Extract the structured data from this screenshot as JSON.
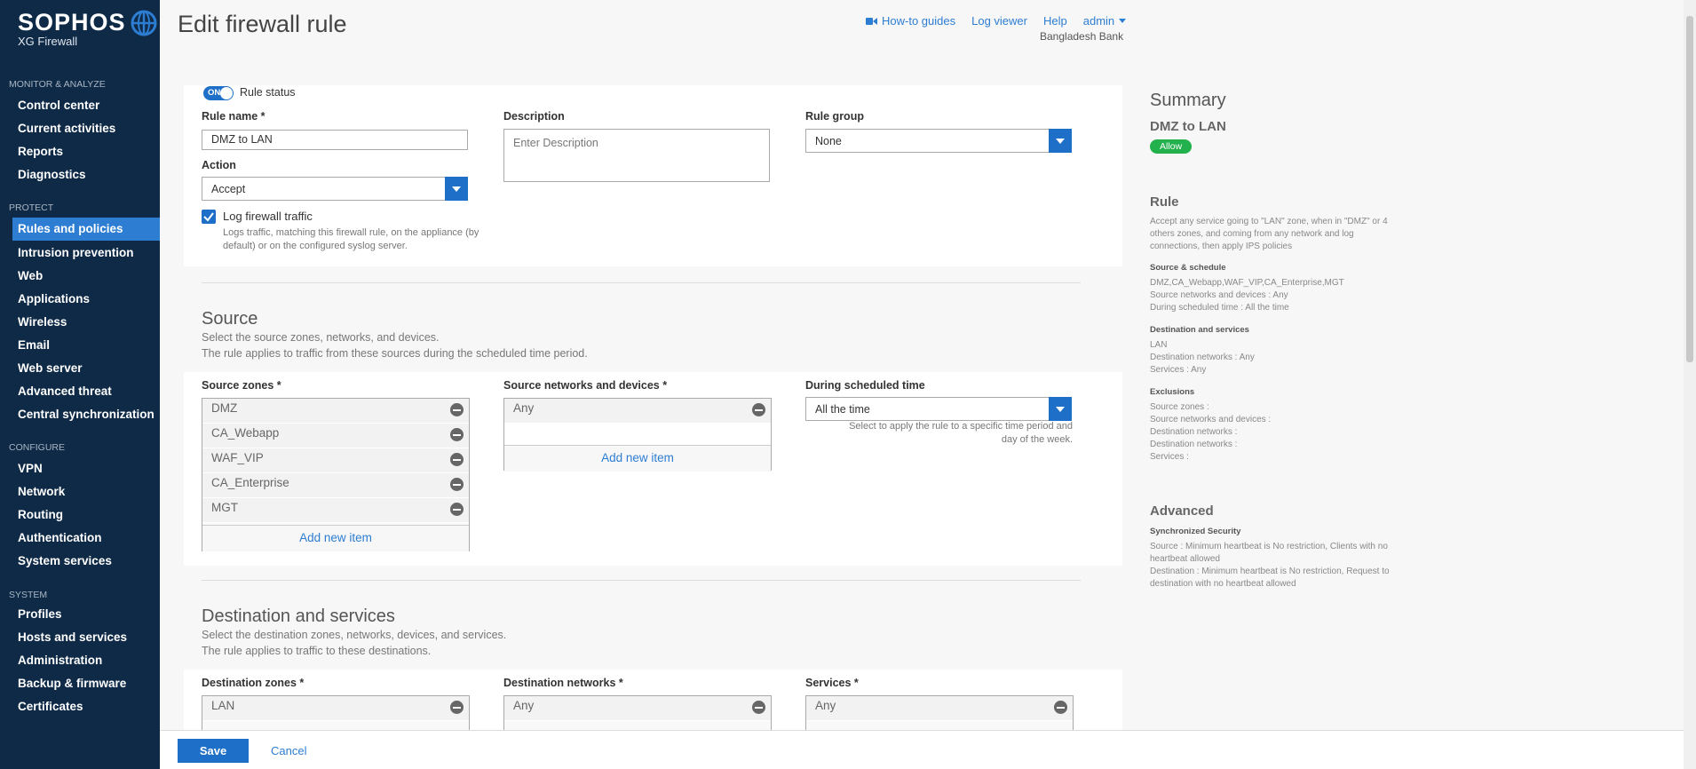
{
  "brand": {
    "name": "SOPHOS",
    "product": "XG Firewall"
  },
  "nav": {
    "sections": [
      {
        "label": "MONITOR & ANALYZE",
        "items": [
          "Control center",
          "Current activities",
          "Reports",
          "Diagnostics"
        ]
      },
      {
        "label": "PROTECT",
        "items": [
          "Rules and policies",
          "Intrusion prevention",
          "Web",
          "Applications",
          "Wireless",
          "Email",
          "Web server",
          "Advanced threat",
          "Central synchronization"
        ]
      },
      {
        "label": "CONFIGURE",
        "items": [
          "VPN",
          "Network",
          "Routing",
          "Authentication",
          "System services"
        ]
      },
      {
        "label": "SYSTEM",
        "items": [
          "Profiles",
          "Hosts and services",
          "Administration",
          "Backup & firmware",
          "Certificates"
        ]
      }
    ],
    "active": "Rules and policies"
  },
  "header": {
    "title": "Edit firewall rule",
    "links": {
      "howto": "How-to guides",
      "log": "Log viewer",
      "help": "Help",
      "admin": "admin"
    },
    "org": "Bangladesh Bank"
  },
  "rule": {
    "toggle_label": "ON",
    "status_label": "Rule status",
    "name_label": "Rule name *",
    "name_value": "DMZ to LAN",
    "desc_label": "Description",
    "desc_placeholder": "Enter Description",
    "group_label": "Rule group",
    "group_value": "None",
    "action_label": "Action",
    "action_value": "Accept",
    "log_label": "Log firewall traffic",
    "log_help": "Logs traffic, matching this firewall rule, on the appliance (by default) or on the configured syslog server."
  },
  "source": {
    "title": "Source",
    "desc1": "Select the source zones, networks, and devices.",
    "desc2": "The rule applies to traffic from these sources during the scheduled time period.",
    "zones_label": "Source zones *",
    "zones": [
      "DMZ",
      "CA_Webapp",
      "WAF_VIP",
      "CA_Enterprise",
      "MGT"
    ],
    "networks_label": "Source networks and devices *",
    "networks": [
      "Any"
    ],
    "schedule_label": "During scheduled time",
    "schedule_value": "All the time",
    "schedule_help": "Select to apply the rule to a specific time period and day of the week.",
    "add_new": "Add new item"
  },
  "destination": {
    "title": "Destination and services",
    "desc1": "Select the destination zones, networks, devices, and services.",
    "desc2": "The rule applies to traffic to these destinations.",
    "zones_label": "Destination zones *",
    "zones": [
      "LAN"
    ],
    "networks_label": "Destination networks *",
    "networks": [
      "Any"
    ],
    "services_label": "Services *",
    "services": [
      "Any"
    ]
  },
  "summary": {
    "title": "Summary",
    "rule_name": "DMZ to LAN",
    "badge": "Allow",
    "rule_h": "Rule",
    "rule_text": "Accept any service going to \"LAN\" zone, when in \"DMZ\" or 4 others zones, and coming from any network and log connections, then apply IPS policies",
    "src_h": "Source & schedule",
    "src_lines": [
      "DMZ,CA_Webapp,WAF_VIP,CA_Enterprise,MGT",
      "Source networks and devices : Any",
      "During scheduled time : All the time"
    ],
    "dst_h": "Destination and services",
    "dst_lines": [
      "LAN",
      "Destination networks : Any",
      "Services : Any"
    ],
    "exc_h": "Exclusions",
    "exc_lines": [
      "Source zones :",
      "Source networks and devices :",
      "Destination networks :",
      "Destination networks :",
      "Services :"
    ],
    "adv_h": "Advanced",
    "sync_h": "Synchronized Security",
    "sync_src": "Source : Minimum heartbeat is No restriction, Clients with no heartbeat allowed",
    "sync_dst": "Destination : Minimum heartbeat is No restriction, Request to destination with no heartbeat allowed"
  },
  "footer": {
    "save": "Save",
    "cancel": "Cancel"
  }
}
